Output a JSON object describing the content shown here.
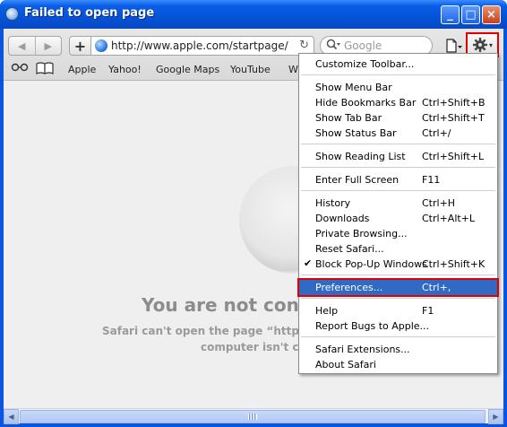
{
  "window": {
    "title": "Failed to open page",
    "controls": {
      "minimize": "_",
      "maximize": "□",
      "close": "×"
    }
  },
  "toolbar": {
    "back_icon": "◀",
    "forward_icon": "▶",
    "add_icon": "+",
    "address": "http://www.apple.com/startpage/",
    "reload_icon": "↻",
    "search_placeholder": "Google",
    "page_icon": "🗋",
    "gear_icon": "✱",
    "gear_caret": "▾",
    "highlight_color": "#e00000"
  },
  "bookmarks": {
    "reading_icon": "◎◎",
    "book_icon": "📖",
    "items": [
      "Apple",
      "Yahoo!",
      "Google Maps",
      "YouTube",
      "Wi"
    ]
  },
  "page": {
    "title": "You are not conne",
    "line1": "Safari can't open the page “http:\\",
    "line2": "computer isn't co"
  },
  "menu": {
    "items": [
      {
        "label": "Customize Toolbar...",
        "shortcut": ""
      },
      {
        "label": "Show Menu Bar",
        "shortcut": ""
      },
      {
        "label": "Hide Bookmarks Bar",
        "shortcut": "Ctrl+Shift+B"
      },
      {
        "label": "Show Tab Bar",
        "shortcut": "Ctrl+Shift+T"
      },
      {
        "label": "Show Status Bar",
        "shortcut": "Ctrl+/"
      },
      {
        "label": "Show Reading List",
        "shortcut": "Ctrl+Shift+L"
      },
      {
        "label": "Enter Full Screen",
        "shortcut": "F11"
      },
      {
        "label": "History",
        "shortcut": "Ctrl+H"
      },
      {
        "label": "Downloads",
        "shortcut": "Ctrl+Alt+L"
      },
      {
        "label": "Private Browsing...",
        "shortcut": ""
      },
      {
        "label": "Reset Safari...",
        "shortcut": ""
      },
      {
        "label": "Block Pop-Up Windows",
        "shortcut": "Ctrl+Shift+K",
        "checked": true
      },
      {
        "label": "Preferences...",
        "shortcut": "Ctrl+,",
        "highlighted": true
      },
      {
        "label": "Help",
        "shortcut": "F1"
      },
      {
        "label": "Report Bugs to Apple...",
        "shortcut": ""
      },
      {
        "label": "Safari Extensions...",
        "shortcut": ""
      },
      {
        "label": "About Safari",
        "shortcut": ""
      }
    ],
    "check_mark": "✔"
  }
}
